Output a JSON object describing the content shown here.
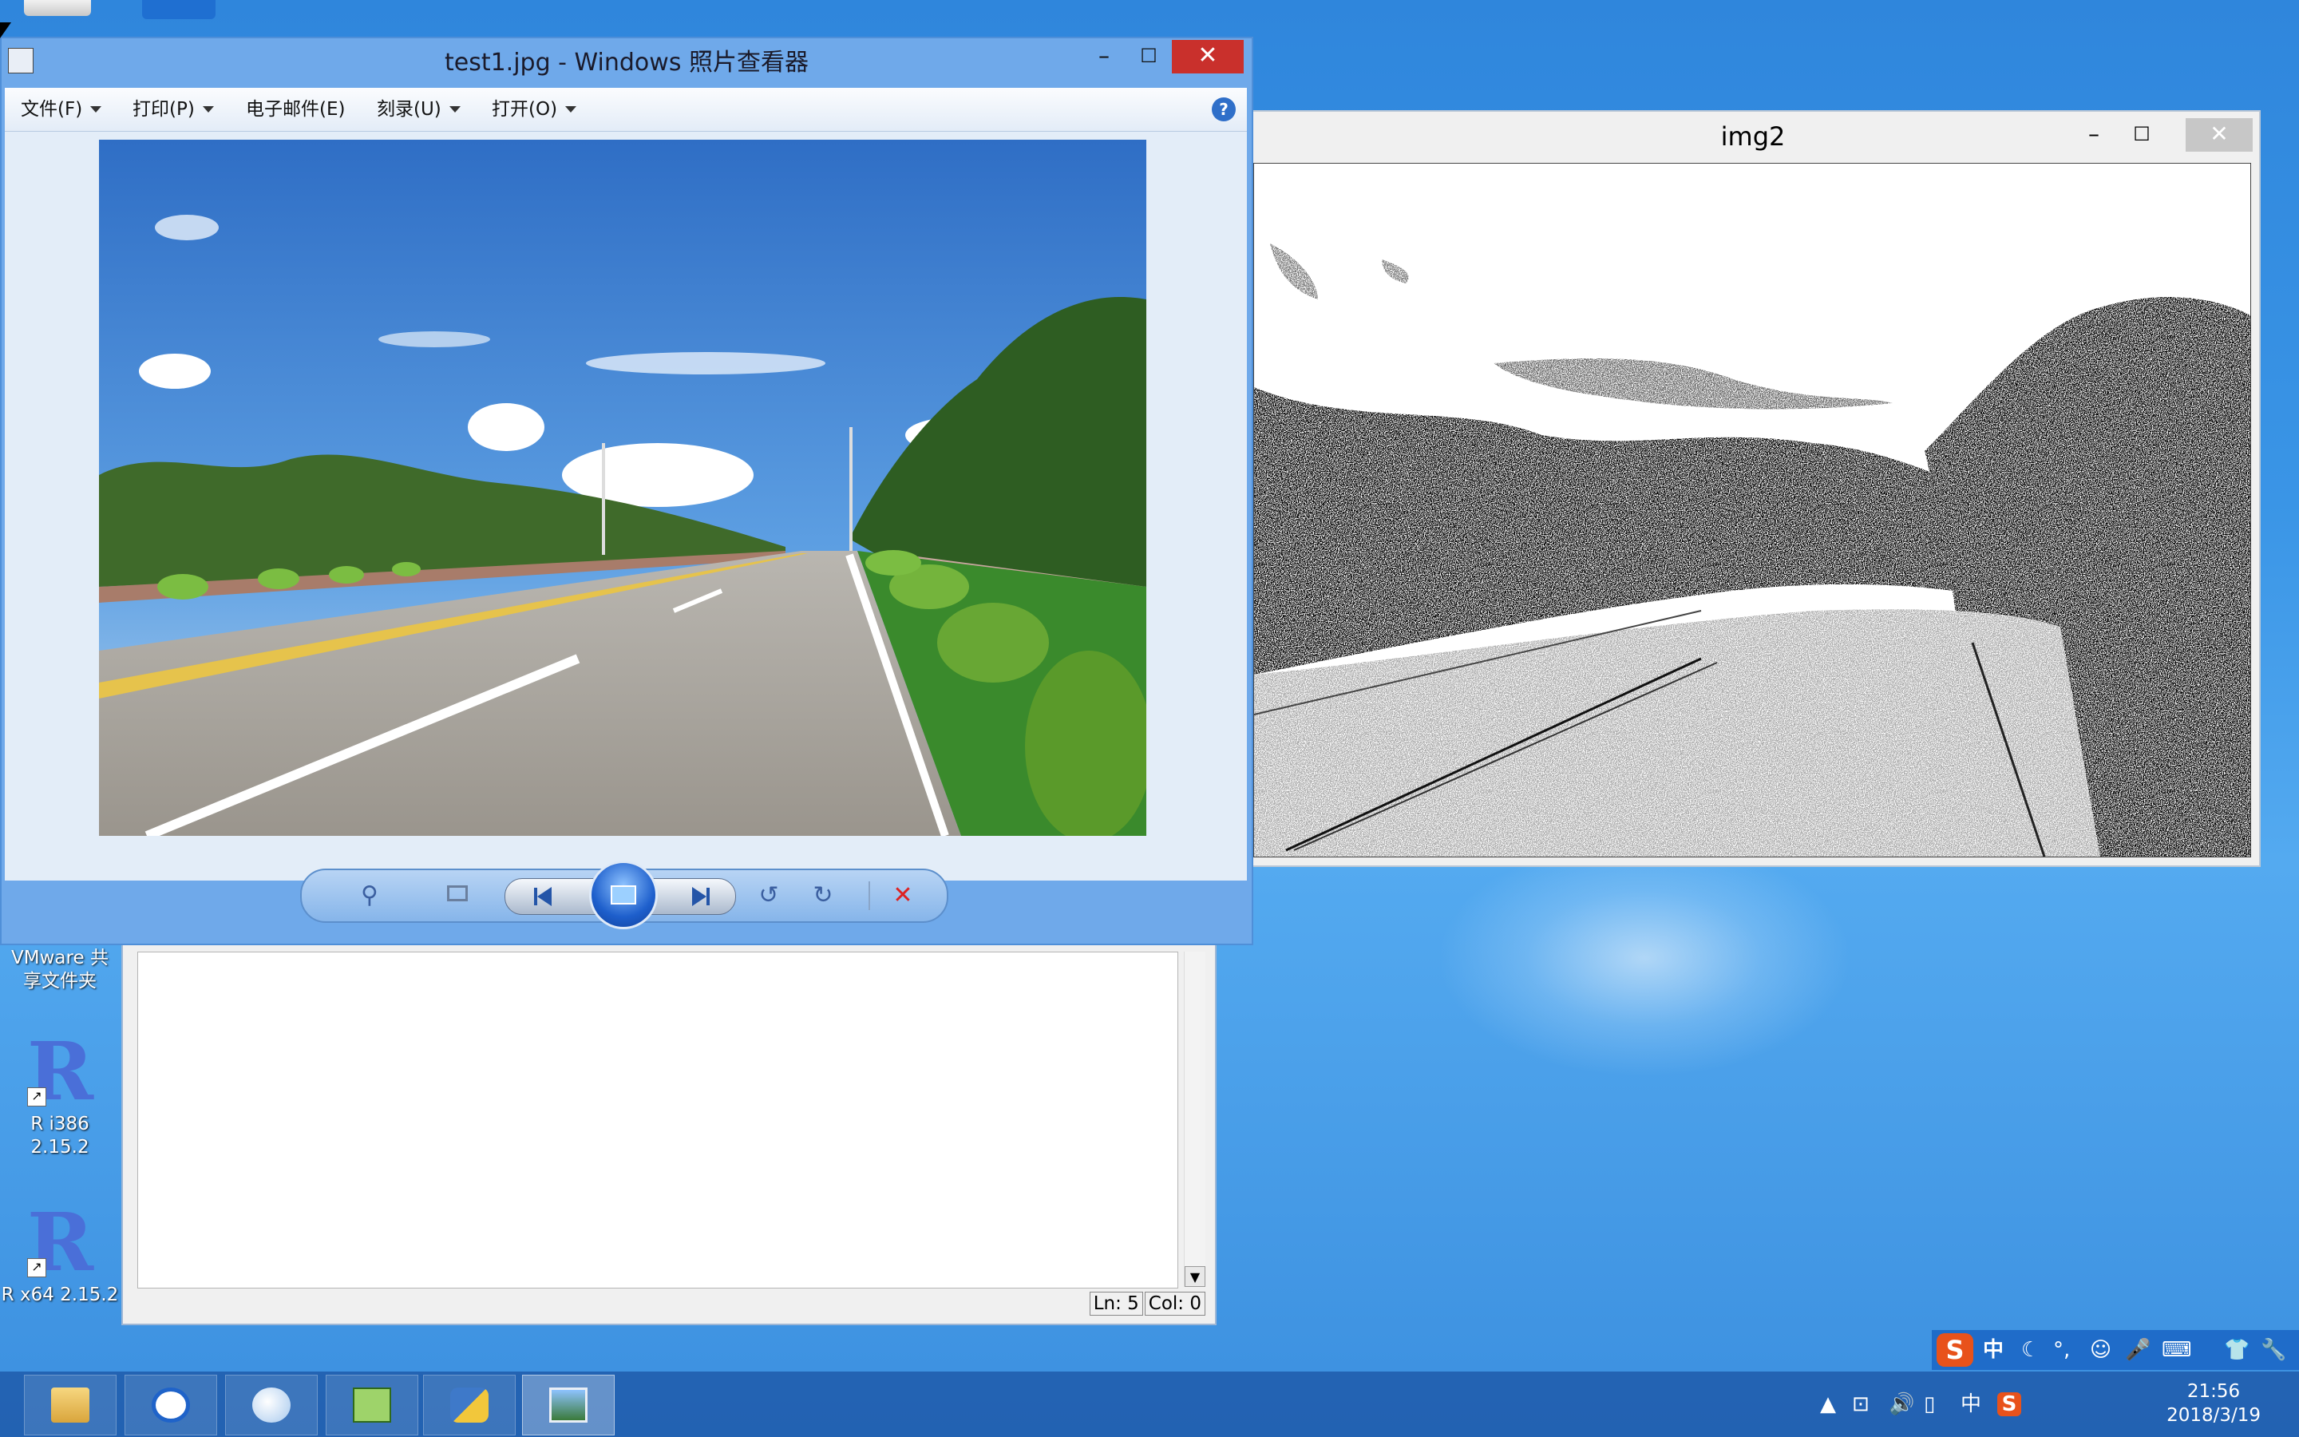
{
  "desktop": {
    "icons": [
      {
        "label": "VMware 共享文件夹"
      },
      {
        "label": "R i386 2.15.2"
      },
      {
        "label": "R x64 2.15.2"
      }
    ]
  },
  "editor": {
    "status_ln": "Ln: 5",
    "status_col": "Col: 0",
    "scroll_down_icon": "▼"
  },
  "img2_window": {
    "title": "img2",
    "minimize": "–",
    "maximize": "☐",
    "close": "✕"
  },
  "photo_viewer": {
    "title": "test1.jpg - Windows 照片查看器",
    "minimize": "–",
    "maximize": "☐",
    "close": "✕",
    "menu": [
      {
        "label": "文件(F)"
      },
      {
        "label": "打印(P)"
      },
      {
        "label": "电子邮件(E)"
      },
      {
        "label": "刻录(U)"
      },
      {
        "label": "打开(O)"
      }
    ],
    "help": "?",
    "controls": {
      "zoom": "zoom-icon",
      "fit": "fit-window-icon",
      "previous": "previous-icon",
      "slideshow": "slideshow-icon",
      "next": "next-icon",
      "rotate_left": "rotate-ccw-icon",
      "rotate_right": "rotate-cw-icon",
      "delete": "delete-icon",
      "delete_glyph": "✕",
      "rotate_left_glyph": "↺",
      "rotate_right_glyph": "↻",
      "zoom_glyph": "⚲"
    }
  },
  "ime_bar": {
    "logo": "S",
    "lang": "中",
    "items": [
      "☾",
      "°,",
      "☺",
      "🎤",
      "⌨",
      "👕",
      "🔧"
    ]
  },
  "taskbar": {
    "apps": [
      {
        "name": "file-explorer-icon"
      },
      {
        "name": "sogou-browser-icon"
      },
      {
        "name": "quill-icon"
      },
      {
        "name": "notepad-plus-icon"
      },
      {
        "name": "python-icon"
      },
      {
        "name": "photo-viewer-icon"
      }
    ],
    "tray": {
      "lang": "中",
      "time": "21:56",
      "date": "2018/3/19"
    }
  },
  "colors": {
    "desktop_top": "#2f86dc",
    "viewer_frame": "#6fa9ea",
    "close_red": "#c9302c",
    "taskbar": "#1e5aaa"
  }
}
